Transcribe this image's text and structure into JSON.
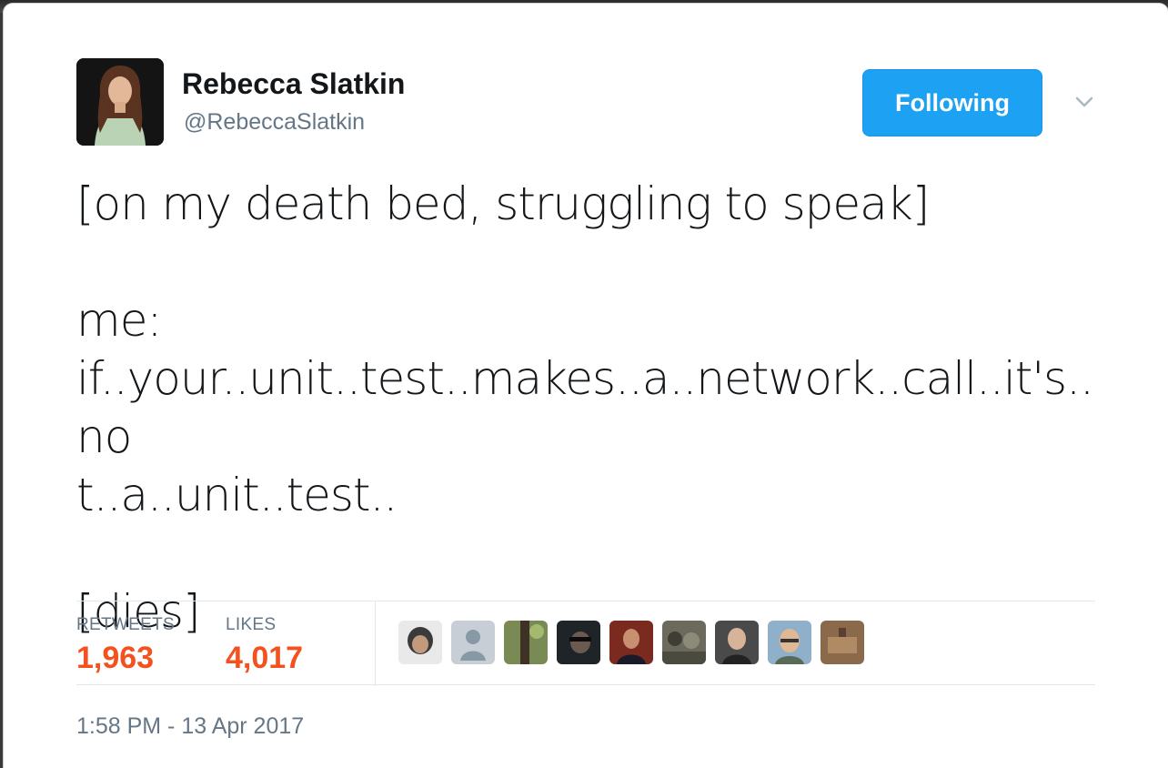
{
  "author": {
    "name": "Rebecca Slatkin",
    "handle": "@RebeccaSlatkin"
  },
  "follow_button": {
    "label": "Following"
  },
  "tweet": {
    "lines": [
      "[on my death bed, struggling to speak]",
      "",
      "me:",
      "if..your..unit..test..makes..a..network..call..it's..no",
      "t..a..unit..test..",
      "",
      "[dies]"
    ]
  },
  "stats": {
    "retweets_label": "RETWEETS",
    "retweets_value": "1,963",
    "likes_label": "LIKES",
    "likes_value": "4,017"
  },
  "likers": [
    {
      "color": "#3b3b3b"
    },
    {
      "color": "#c7ced6"
    },
    {
      "color": "#5b6e3a"
    },
    {
      "color": "#2f3a40"
    },
    {
      "color": "#7a2a1e"
    },
    {
      "color": "#6b6a5c"
    },
    {
      "color": "#4a4a4a"
    },
    {
      "color": "#8fb0c8"
    },
    {
      "color": "#8a6a4a"
    }
  ],
  "timestamp": "1:58 PM - 13 Apr 2017",
  "colors": {
    "accent": "#1da1f2",
    "stat_value": "#f4511e",
    "muted": "#657786"
  }
}
